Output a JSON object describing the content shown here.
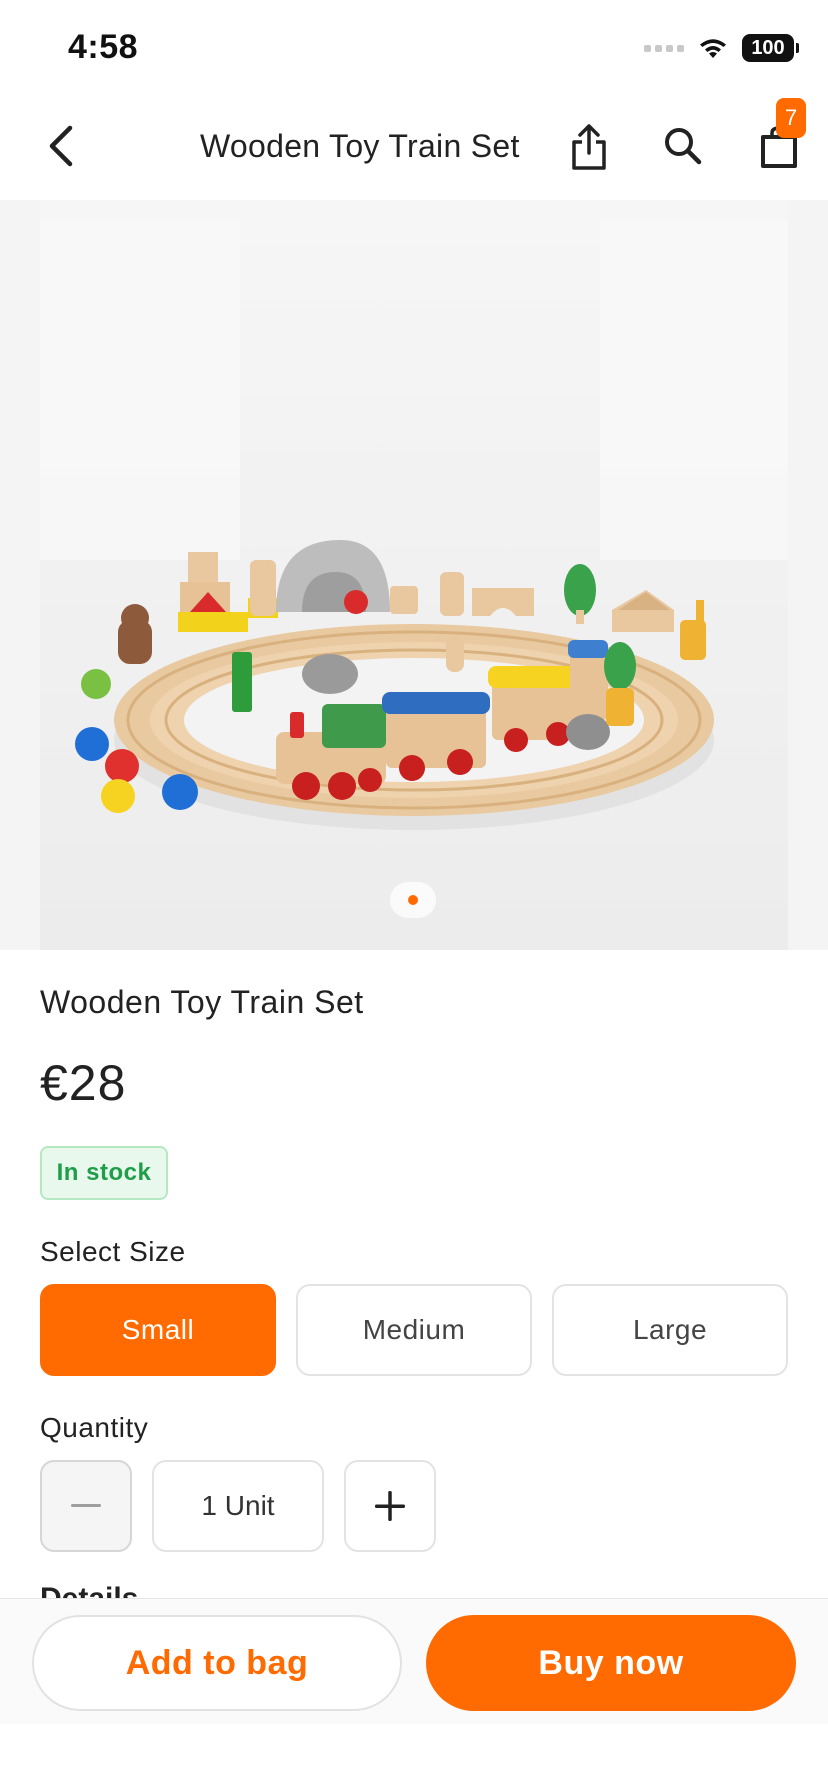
{
  "status_bar": {
    "time": "4:58",
    "battery": "100"
  },
  "nav": {
    "title": "Wooden Toy Train Set",
    "cart_count": "7",
    "icons": [
      "chevron-left-icon",
      "share-icon",
      "search-icon",
      "shopping-bag-icon"
    ]
  },
  "gallery": {
    "image_subject": "Wooden toy train on a circular track surrounded by blocks, animals and felt balls",
    "page_count": 1,
    "active_page": 1
  },
  "product": {
    "name": "Wooden Toy Train Set",
    "price": "€28",
    "stock_status": "In stock"
  },
  "size": {
    "label": "Select Size",
    "options": [
      "Small",
      "Medium",
      "Large"
    ],
    "selected": "Small"
  },
  "quantity": {
    "label": "Quantity",
    "value": "1 Unit"
  },
  "details": {
    "heading_partial": "Details"
  },
  "actions": {
    "add_to_bag": "Add to bag",
    "buy_now": "Buy now"
  },
  "colors": {
    "accent": "#ff6b00",
    "in_stock_text": "#1f9d48",
    "in_stock_bg": "#e8f8ec"
  }
}
